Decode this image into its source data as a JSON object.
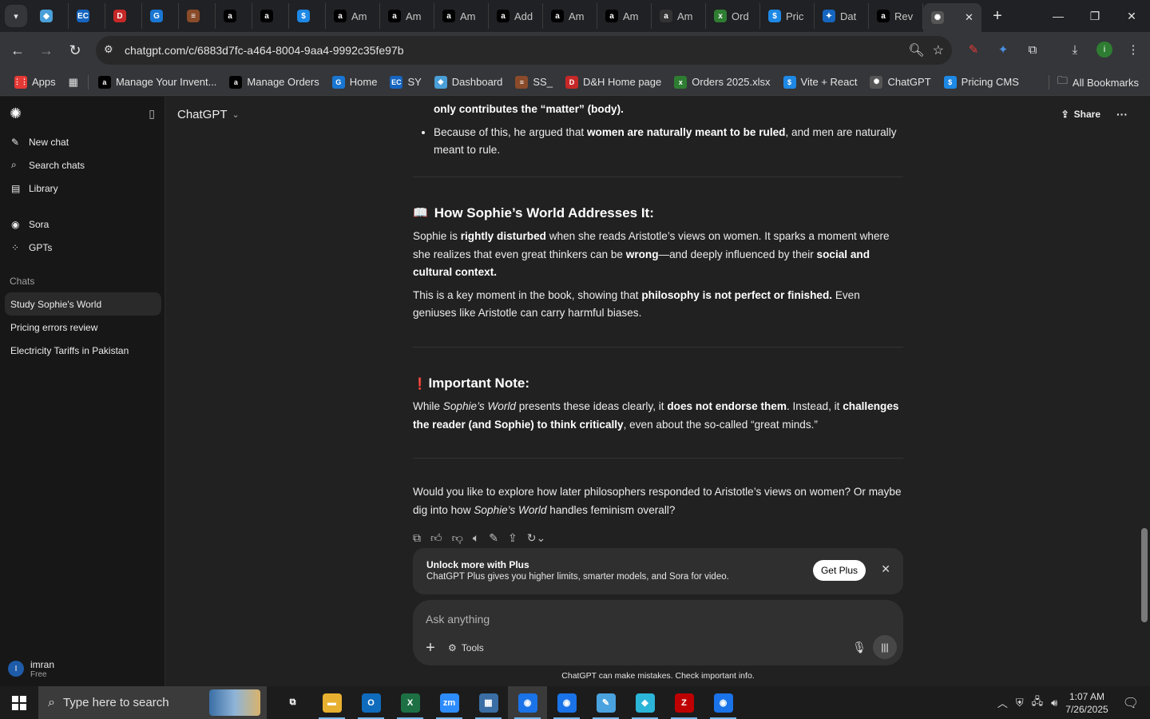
{
  "tabs": [
    {
      "label": "",
      "color": "#4a9fd8",
      "glyph": "◆"
    },
    {
      "label": "",
      "color": "#1565c0",
      "glyph": "EC"
    },
    {
      "label": "",
      "color": "#c62828",
      "glyph": "D"
    },
    {
      "label": "",
      "color": "#1976d2",
      "glyph": "G"
    },
    {
      "label": "",
      "color": "#8a4b2a",
      "glyph": "≡"
    },
    {
      "label": "",
      "color": "#000000",
      "glyph": "a"
    },
    {
      "label": "",
      "color": "#000000",
      "glyph": "a"
    },
    {
      "label": "",
      "color": "#1e88e5",
      "glyph": "$"
    },
    {
      "label": "Am",
      "color": "#000000",
      "glyph": "a"
    },
    {
      "label": "Am",
      "color": "#000000",
      "glyph": "a"
    },
    {
      "label": "Am",
      "color": "#000000",
      "glyph": "a"
    },
    {
      "label": "Add",
      "color": "#000000",
      "glyph": "a"
    },
    {
      "label": "Am",
      "color": "#000000",
      "glyph": "a"
    },
    {
      "label": "Am",
      "color": "#000000",
      "glyph": "a"
    },
    {
      "label": "Am",
      "color": "#333333",
      "glyph": "a"
    },
    {
      "label": "Ord",
      "color": "#2e7d32",
      "glyph": "x"
    },
    {
      "label": "Pric",
      "color": "#1e88e5",
      "glyph": "$"
    },
    {
      "label": "Dat",
      "color": "#1565c0",
      "glyph": "✦"
    },
    {
      "label": "Rev",
      "color": "#000000",
      "glyph": "a"
    }
  ],
  "browser": {
    "url": "chatgpt.com/c/6883d7fc-a464-8004-9aa4-9992c35fe97b"
  },
  "bookmarks": [
    {
      "label": "Apps",
      "color": "#e53935",
      "glyph": "⋮⋮"
    },
    {
      "label": "Manage Your Invent...",
      "color": "#000000",
      "glyph": "a"
    },
    {
      "label": "Manage Orders",
      "color": "#000000",
      "glyph": "a"
    },
    {
      "label": "Home",
      "color": "#1976d2",
      "glyph": "G"
    },
    {
      "label": "SY",
      "color": "#1565c0",
      "glyph": "EC"
    },
    {
      "label": "Dashboard",
      "color": "#4a9fd8",
      "glyph": "◆"
    },
    {
      "label": "SS_",
      "color": "#8a4b2a",
      "glyph": "≡"
    },
    {
      "label": "D&H Home page",
      "color": "#c62828",
      "glyph": "D"
    },
    {
      "label": "Orders 2025.xlsx",
      "color": "#2e7d32",
      "glyph": "x"
    },
    {
      "label": "Vite + React",
      "color": "#1e88e5",
      "glyph": "$"
    },
    {
      "label": "ChatGPT",
      "color": "#555555",
      "glyph": "✺"
    },
    {
      "label": "Pricing CMS",
      "color": "#1e88e5",
      "glyph": "$"
    }
  ],
  "all_bookmarks": "All Bookmarks",
  "sidebar": {
    "nav": [
      {
        "label": "New chat",
        "icon": "✎"
      },
      {
        "label": "Search chats",
        "icon": "⌕"
      },
      {
        "label": "Library",
        "icon": "▤"
      }
    ],
    "nav2": [
      {
        "label": "Sora",
        "icon": "◉"
      },
      {
        "label": "GPTs",
        "icon": "⁘"
      }
    ],
    "chats_label": "Chats",
    "chats": [
      "Study Sophie's World",
      "Pricing errors review",
      "Electricity Tariffs in Pakistan"
    ],
    "user": {
      "name": "imran",
      "plan": "Free",
      "initial": "I"
    }
  },
  "header": {
    "model": "ChatGPT",
    "share": "Share"
  },
  "message": {
    "bullet1_bold": "only contributes the “matter” (body).",
    "bullet2_a": "Because of this, he argued that ",
    "bullet2_b": "women are naturally meant to be ruled",
    "bullet2_c": ", and men are naturally meant to rule.",
    "h_sophie_icon": "📖",
    "h_sophie": "How Sophie’s World Addresses It:",
    "p1_a": "Sophie is ",
    "p1_b": "rightly disturbed",
    "p1_c": " when she reads Aristotle’s views on women. It sparks a moment where she realizes that even great thinkers can be ",
    "p1_d": "wrong",
    "p1_e": "—and deeply influenced by their ",
    "p1_f": "social and cultural context.",
    "p2_a": "This is a key moment in the book, showing that ",
    "p2_b": "philosophy is not perfect or finished.",
    "p2_c": " Even geniuses like Aristotle can carry harmful biases.",
    "h_note_icon": "❗",
    "h_note": "Important Note:",
    "p3_a": "While ",
    "p3_i": "Sophie’s World",
    "p3_b": " presents these ideas clearly, it ",
    "p3_c": "does not endorse them",
    "p3_d": ". Instead, it ",
    "p3_e": "challenges the reader (and Sophie) to think critically",
    "p3_f": ", even about the so-called “great minds.”",
    "p4_a": "Would you like to explore how later philosophers responded to Aristotle’s views on women? Or maybe dig into how ",
    "p4_i": "Sophie’s World",
    "p4_b": " handles feminism overall?"
  },
  "plus": {
    "title": "Unlock more with Plus",
    "desc": "ChatGPT Plus gives you higher limits, smarter models, and Sora for video.",
    "button": "Get Plus"
  },
  "composer": {
    "placeholder": "Ask anything",
    "tools": "Tools"
  },
  "disclaimer": "ChatGPT can make mistakes. Check important info.",
  "taskbar": {
    "search_placeholder": "Type here to search",
    "time": "1:07 AM",
    "date": "7/26/2025",
    "apps": [
      {
        "name": "task-view",
        "color": "#1c1c1c",
        "glyph": "⧉"
      },
      {
        "name": "file-explorer",
        "color": "#e8b030",
        "glyph": "▬"
      },
      {
        "name": "outlook",
        "color": "#0f6cbd",
        "glyph": "O"
      },
      {
        "name": "excel",
        "color": "#1d7044",
        "glyph": "X"
      },
      {
        "name": "zoom",
        "color": "#2d8cff",
        "glyph": "zm"
      },
      {
        "name": "calculator",
        "color": "#3a6ea5",
        "glyph": "▦"
      },
      {
        "name": "chrome",
        "color": "#1a73e8",
        "glyph": "◉"
      },
      {
        "name": "chrome-profile",
        "color": "#1a73e8",
        "glyph": "◉"
      },
      {
        "name": "notes",
        "color": "#4aa3df",
        "glyph": "✎"
      },
      {
        "name": "vpn",
        "color": "#2bb5d8",
        "glyph": "◆"
      },
      {
        "name": "filezilla",
        "color": "#bf0000",
        "glyph": "Z"
      },
      {
        "name": "chrome-2",
        "color": "#1a73e8",
        "glyph": "◉"
      }
    ]
  }
}
